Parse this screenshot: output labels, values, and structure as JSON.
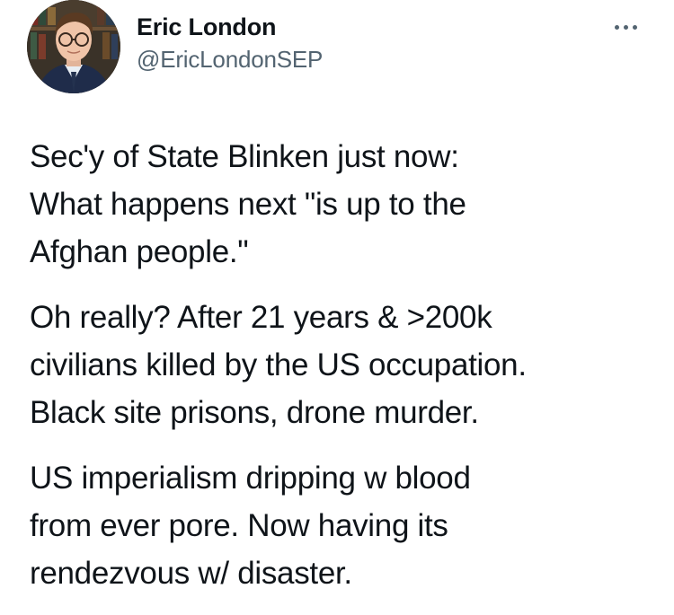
{
  "author": {
    "display_name": "Eric London",
    "handle": "@EricLondonSEP"
  },
  "icons": {
    "more": "more-horizontal-icon"
  },
  "colors": {
    "text": "#0f1419",
    "secondary": "#536471",
    "background": "#ffffff"
  },
  "tweet": {
    "paragraphs": [
      "Sec'y of State Blinken just now:\nWhat happens next \"is up to the\nAfghan people.\"",
      "Oh really? After 21 years & >200k\ncivilians killed by the US occupation.\nBlack site prisons, drone murder.",
      "US imperialism dripping w blood\nfrom ever pore. Now having its\nrendezvous w/ disaster."
    ]
  }
}
